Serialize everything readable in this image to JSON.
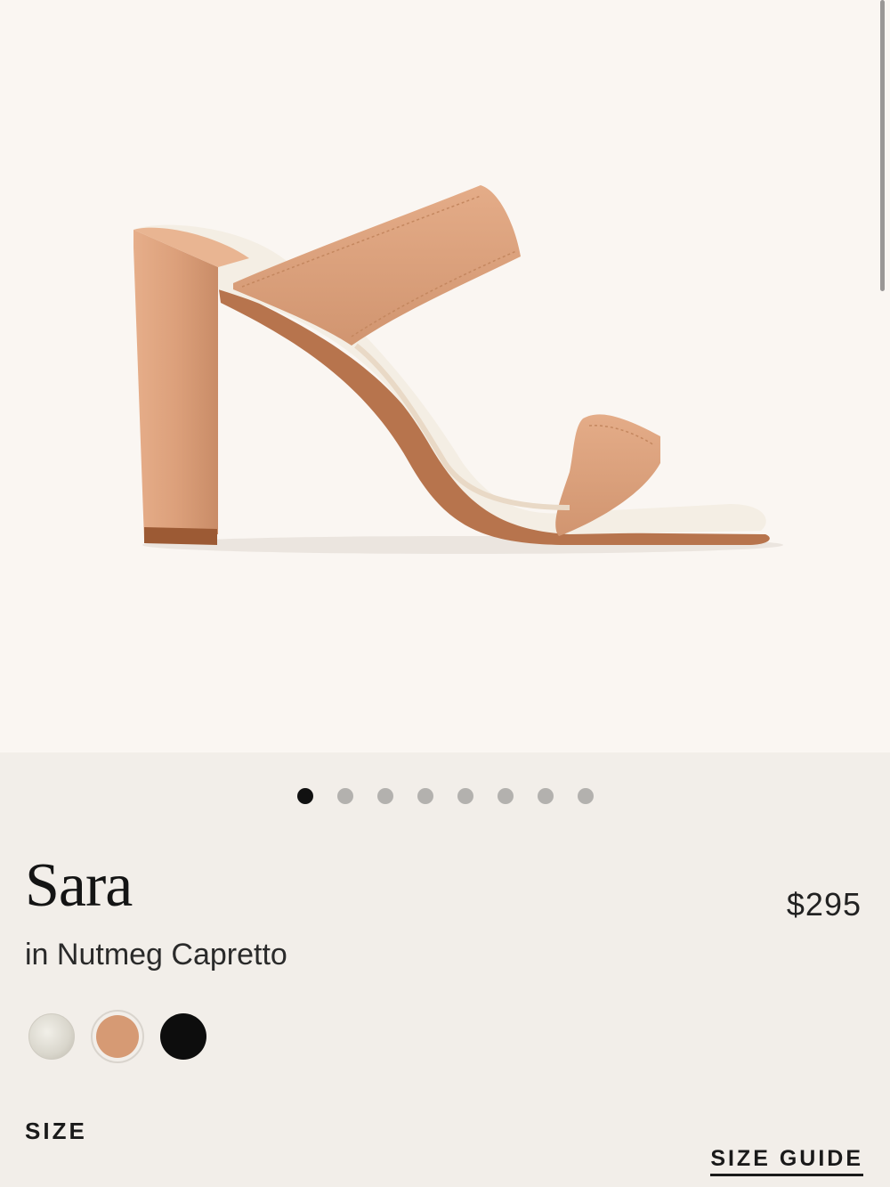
{
  "product": {
    "name": "Sara",
    "color_subtitle": "in Nutmeg Capretto",
    "price": "$295",
    "image_icon": "sandal-product-image"
  },
  "carousel": {
    "total": 8,
    "active_index": 0
  },
  "swatches": [
    {
      "name": "swatch-silver-metallic",
      "color": "#d9d6cc",
      "selected": false
    },
    {
      "name": "swatch-nutmeg",
      "color": "#d69a74",
      "selected": true
    },
    {
      "name": "swatch-black",
      "color": "#0d0d0d",
      "selected": false
    }
  ],
  "size_section": {
    "label": "SIZE",
    "guide_label": "SIZE GUIDE"
  },
  "colors": {
    "hero_bg": "#faf6f2",
    "page_bg": "#f2eee9",
    "leather": "#dca27e"
  }
}
